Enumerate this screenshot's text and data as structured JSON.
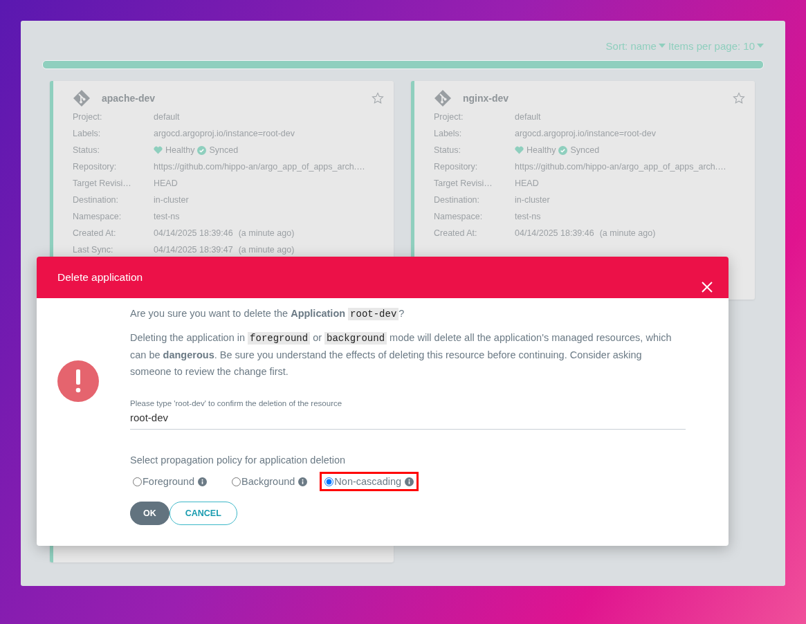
{
  "toolbar": {
    "sort": "Sort: name",
    "per_page": "Items per page: 10"
  },
  "sync_bar": {
    "level": 1
  },
  "apps": [
    {
      "name": "apache-dev",
      "favorite": false,
      "fields": [
        {
          "kind": "text",
          "label": "Project:",
          "value": "default"
        },
        {
          "kind": "text",
          "label": "Labels:",
          "value": "argocd.argoproj.io/instance=root-dev"
        },
        {
          "kind": "status",
          "label": "Status:",
          "health": "Healthy",
          "sync": "Synced"
        },
        {
          "kind": "text",
          "label": "Repository:",
          "value": "https://github.com/hippo-an/argo_app_of_apps_arch.…"
        },
        {
          "kind": "text",
          "label": "Target Revisi…",
          "value": "HEAD"
        },
        {
          "kind": "text",
          "label": "Destination:",
          "value": "in-cluster"
        },
        {
          "kind": "text",
          "label": "Namespace:",
          "value": "test-ns"
        },
        {
          "kind": "time",
          "label": "Created At:",
          "value": "04/14/2025 18:39:46",
          "ago": "(a minute ago)"
        },
        {
          "kind": "time",
          "label": "Last Sync:",
          "value": "04/14/2025 18:39:47",
          "ago": "(a minute ago)"
        }
      ]
    },
    {
      "name": "nginx-dev",
      "favorite": false,
      "fields": [
        {
          "kind": "text",
          "label": "Project:",
          "value": "default"
        },
        {
          "kind": "text",
          "label": "Labels:",
          "value": "argocd.argoproj.io/instance=root-dev"
        },
        {
          "kind": "status",
          "label": "Status:",
          "health": "Healthy",
          "sync": "Synced"
        },
        {
          "kind": "text",
          "label": "Repository:",
          "value": "https://github.com/hippo-an/argo_app_of_apps_arch.…"
        },
        {
          "kind": "text",
          "label": "Target Revisi…",
          "value": "HEAD"
        },
        {
          "kind": "text",
          "label": "Destination:",
          "value": "in-cluster"
        },
        {
          "kind": "text",
          "label": "Namespace:",
          "value": "test-ns"
        },
        {
          "kind": "time",
          "label": "Created At:",
          "value": "04/14/2025 18:39:46",
          "ago": "(a minute ago)"
        }
      ]
    }
  ],
  "dialog": {
    "title": "Delete application",
    "paragraphs": [
      [
        {
          "kind": "text",
          "text": "Are you sure you want to delete the "
        },
        {
          "kind": "bold",
          "text": "Application"
        },
        {
          "kind": "code",
          "text": "root-dev"
        },
        {
          "kind": "text",
          "text": "?"
        }
      ],
      [
        {
          "kind": "text",
          "text": "Deleting the application in "
        },
        {
          "kind": "code",
          "text": "foreground"
        },
        {
          "kind": "text",
          "text": " or "
        },
        {
          "kind": "code",
          "text": "background"
        },
        {
          "kind": "text",
          "text": " mode will delete all the application's managed resources, which can be "
        },
        {
          "kind": "bold",
          "text": "dangerous"
        },
        {
          "kind": "text",
          "text": ". Be sure you understand the effects of deleting this resource before continuing. Consider asking someone to review the change first."
        }
      ]
    ],
    "confirm": {
      "label": "Please type 'root-dev' to confirm the deletion of the resource",
      "value": "root-dev"
    },
    "policy_label": "Select propagation policy for application deletion",
    "policies": [
      {
        "label": "Foreground",
        "selected": false,
        "highlighted": false
      },
      {
        "label": "Background",
        "selected": false,
        "highlighted": false
      },
      {
        "label": "Non-cascading",
        "selected": true,
        "highlighted": true
      }
    ],
    "buttons": [
      {
        "kind": "primary",
        "label": "OK"
      },
      {
        "kind": "secondary",
        "label": "CANCEL"
      }
    ]
  }
}
